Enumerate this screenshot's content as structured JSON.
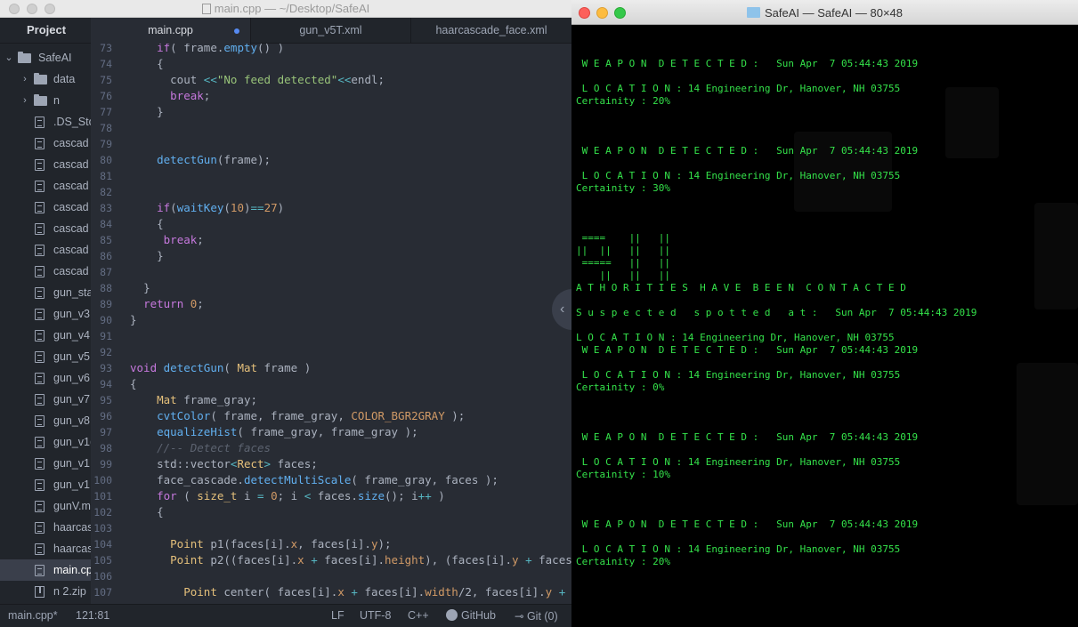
{
  "editor": {
    "window_title": "main.cpp — ~/Desktop/SafeAI",
    "sidebar": {
      "header": "Project",
      "root": "SafeAI",
      "items": [
        {
          "label": "data",
          "kind": "folder"
        },
        {
          "label": "n",
          "kind": "folder"
        },
        {
          "label": ".DS_Sto",
          "kind": "file"
        },
        {
          "label": "cascad",
          "kind": "file"
        },
        {
          "label": "cascad",
          "kind": "file"
        },
        {
          "label": "cascad",
          "kind": "file"
        },
        {
          "label": "cascad",
          "kind": "file"
        },
        {
          "label": "cascad",
          "kind": "file"
        },
        {
          "label": "cascad",
          "kind": "file"
        },
        {
          "label": "cascad",
          "kind": "file"
        },
        {
          "label": "gun_sta",
          "kind": "file"
        },
        {
          "label": "gun_v3",
          "kind": "file"
        },
        {
          "label": "gun_v4",
          "kind": "file"
        },
        {
          "label": "gun_v5",
          "kind": "file"
        },
        {
          "label": "gun_v6",
          "kind": "file"
        },
        {
          "label": "gun_v7",
          "kind": "file"
        },
        {
          "label": "gun_v8",
          "kind": "file"
        },
        {
          "label": "gun_v1(",
          "kind": "file"
        },
        {
          "label": "gun_v1",
          "kind": "file"
        },
        {
          "label": "gun_v1",
          "kind": "file"
        },
        {
          "label": "gunV.m",
          "kind": "file"
        },
        {
          "label": "haarcas",
          "kind": "file"
        },
        {
          "label": "haarcas",
          "kind": "file"
        },
        {
          "label": "main.cp",
          "kind": "file",
          "selected": true
        },
        {
          "label": "n 2.zip",
          "kind": "zip"
        }
      ]
    },
    "tabs": [
      {
        "label": "main.cpp",
        "active": true,
        "modified": true
      },
      {
        "label": "gun_v5T.xml",
        "active": false
      },
      {
        "label": "haarcascade_face.xml",
        "active": false
      }
    ],
    "code_lines": [
      {
        "n": "73",
        "indent": "    ",
        "tokens": [
          [
            "k",
            "if"
          ],
          [
            "p",
            "( frame."
          ],
          [
            "f",
            "empty"
          ],
          [
            "p",
            "() )"
          ]
        ]
      },
      {
        "n": "74",
        "indent": "    ",
        "tokens": [
          [
            "p",
            "{"
          ]
        ]
      },
      {
        "n": "75",
        "indent": "      ",
        "tokens": [
          [
            "p",
            "cout "
          ],
          [
            "o",
            "<<"
          ],
          [
            "s",
            "\"No feed detected\""
          ],
          [
            "o",
            "<<"
          ],
          [
            "p",
            "endl;"
          ]
        ]
      },
      {
        "n": "76",
        "indent": "      ",
        "tokens": [
          [
            "k",
            "break"
          ],
          [
            "p",
            ";"
          ]
        ]
      },
      {
        "n": "77",
        "indent": "    ",
        "tokens": [
          [
            "p",
            "}"
          ]
        ]
      },
      {
        "n": "78",
        "indent": "",
        "tokens": []
      },
      {
        "n": "79",
        "indent": "",
        "tokens": []
      },
      {
        "n": "80",
        "indent": "    ",
        "tokens": [
          [
            "f",
            "detectGun"
          ],
          [
            "p",
            "(frame);"
          ]
        ]
      },
      {
        "n": "81",
        "indent": "",
        "tokens": []
      },
      {
        "n": "82",
        "indent": "",
        "tokens": []
      },
      {
        "n": "83",
        "indent": "    ",
        "tokens": [
          [
            "k",
            "if"
          ],
          [
            "p",
            "("
          ],
          [
            "f",
            "waitKey"
          ],
          [
            "p",
            "("
          ],
          [
            "n",
            "10"
          ],
          [
            "p",
            ")"
          ],
          [
            "o",
            "=="
          ],
          [
            "n",
            "27"
          ],
          [
            "p",
            ")"
          ]
        ]
      },
      {
        "n": "84",
        "indent": "    ",
        "tokens": [
          [
            "p",
            "{"
          ]
        ]
      },
      {
        "n": "85",
        "indent": "     ",
        "tokens": [
          [
            "k",
            "break"
          ],
          [
            "p",
            ";"
          ]
        ]
      },
      {
        "n": "86",
        "indent": "    ",
        "tokens": [
          [
            "p",
            "}"
          ]
        ]
      },
      {
        "n": "87",
        "indent": "",
        "tokens": []
      },
      {
        "n": "88",
        "indent": "  ",
        "tokens": [
          [
            "p",
            "}"
          ]
        ]
      },
      {
        "n": "89",
        "indent": "  ",
        "tokens": [
          [
            "k",
            "return"
          ],
          [
            "p",
            " "
          ],
          [
            "n",
            "0"
          ],
          [
            "p",
            ";"
          ]
        ]
      },
      {
        "n": "90",
        "indent": "",
        "tokens": [
          [
            "p",
            "}"
          ]
        ]
      },
      {
        "n": "91",
        "indent": "",
        "tokens": []
      },
      {
        "n": "92",
        "indent": "",
        "tokens": []
      },
      {
        "n": "93",
        "indent": "",
        "tokens": [
          [
            "k",
            "void"
          ],
          [
            "p",
            " "
          ],
          [
            "f",
            "detectGun"
          ],
          [
            "p",
            "( "
          ],
          [
            "t",
            "Mat"
          ],
          [
            "p",
            " frame )"
          ]
        ]
      },
      {
        "n": "94",
        "indent": "",
        "tokens": [
          [
            "p",
            "{"
          ]
        ]
      },
      {
        "n": "95",
        "indent": "    ",
        "tokens": [
          [
            "t",
            "Mat"
          ],
          [
            "p",
            " frame_gray;"
          ]
        ]
      },
      {
        "n": "96",
        "indent": "    ",
        "tokens": [
          [
            "f",
            "cvtColor"
          ],
          [
            "p",
            "( frame, frame_gray, "
          ],
          [
            "n",
            "COLOR_BGR2GRAY"
          ],
          [
            "p",
            " );"
          ]
        ]
      },
      {
        "n": "97",
        "indent": "    ",
        "tokens": [
          [
            "f",
            "equalizeHist"
          ],
          [
            "p",
            "( frame_gray, frame_gray );"
          ]
        ]
      },
      {
        "n": "98",
        "indent": "    ",
        "tokens": [
          [
            "c",
            "//-- Detect faces"
          ]
        ]
      },
      {
        "n": "99",
        "indent": "    ",
        "tokens": [
          [
            "p",
            "std::vector"
          ],
          [
            "o",
            "<"
          ],
          [
            "t",
            "Rect"
          ],
          [
            "o",
            ">"
          ],
          [
            "p",
            " faces;"
          ]
        ]
      },
      {
        "n": "100",
        "indent": "    ",
        "tokens": [
          [
            "p",
            "face_cascade."
          ],
          [
            "f",
            "detectMultiScale"
          ],
          [
            "p",
            "( frame_gray, faces );"
          ]
        ]
      },
      {
        "n": "101",
        "indent": "    ",
        "tokens": [
          [
            "k",
            "for"
          ],
          [
            "p",
            " ( "
          ],
          [
            "t",
            "size_t"
          ],
          [
            "p",
            " i "
          ],
          [
            "o",
            "="
          ],
          [
            "p",
            " "
          ],
          [
            "n",
            "0"
          ],
          [
            "p",
            "; i "
          ],
          [
            "o",
            "<"
          ],
          [
            "p",
            " faces."
          ],
          [
            "f",
            "size"
          ],
          [
            "p",
            "(); i"
          ],
          [
            "o",
            "++"
          ],
          [
            "p",
            " )"
          ]
        ]
      },
      {
        "n": "102",
        "indent": "    ",
        "tokens": [
          [
            "p",
            "{"
          ]
        ]
      },
      {
        "n": "103",
        "indent": "",
        "tokens": []
      },
      {
        "n": "104",
        "indent": "      ",
        "tokens": [
          [
            "t",
            "Point"
          ],
          [
            "p",
            " p1(faces[i]."
          ],
          [
            "n",
            "x"
          ],
          [
            "p",
            ", faces[i]."
          ],
          [
            "n",
            "y"
          ],
          [
            "p",
            ");"
          ]
        ]
      },
      {
        "n": "105",
        "indent": "      ",
        "tokens": [
          [
            "t",
            "Point"
          ],
          [
            "p",
            " p2((faces[i]."
          ],
          [
            "n",
            "x"
          ],
          [
            "p",
            " "
          ],
          [
            "o",
            "+"
          ],
          [
            "p",
            " faces[i]."
          ],
          [
            "n",
            "height"
          ],
          [
            "p",
            "), (faces[i]."
          ],
          [
            "n",
            "y"
          ],
          [
            "p",
            " "
          ],
          [
            "o",
            "+"
          ],
          [
            "p",
            " faces[i]"
          ]
        ]
      },
      {
        "n": "106",
        "indent": "",
        "tokens": []
      },
      {
        "n": "107",
        "indent": "        ",
        "tokens": [
          [
            "t",
            "Point"
          ],
          [
            "p",
            " center( faces[i]."
          ],
          [
            "n",
            "x"
          ],
          [
            "p",
            " "
          ],
          [
            "o",
            "+"
          ],
          [
            "p",
            " faces[i]."
          ],
          [
            "n",
            "width"
          ],
          [
            "p",
            "/2, faces[i]."
          ],
          [
            "n",
            "y"
          ],
          [
            "p",
            " "
          ],
          [
            "o",
            "+"
          ],
          [
            "p",
            " face"
          ]
        ]
      }
    ],
    "status": {
      "file": "main.cpp*",
      "cursor": "121:81",
      "line_ending": "LF",
      "encoding": "UTF-8",
      "grammar": "C++",
      "github": "GitHub",
      "git": "Git (0)"
    }
  },
  "terminal": {
    "window_title": "SafeAI — SafeAI — 80×48",
    "lines": [
      " ",
      " ",
      " W E A P O N  D E T E C T E D :   Sun Apr  7 05:44:43 2019",
      " ",
      " L O C A T I O N : 14 Engineering Dr, Hanover, NH 03755",
      "Certainity : 20%",
      " ",
      " ",
      " ",
      " W E A P O N  D E T E C T E D :   Sun Apr  7 05:44:43 2019",
      " ",
      " L O C A T I O N : 14 Engineering Dr, Hanover, NH 03755",
      "Certainity : 30%",
      " ",
      " ",
      " ",
      " ====    ||   ||",
      "||  ||   ||   ||",
      " =====   ||   ||",
      "    ||   ||   ||",
      "A T H O R I T I E S  H A V E  B E E N  C O N T A C T E D",
      " ",
      "S u s p e c t e d   s p o t t e d   a t :   Sun Apr  7 05:44:43 2019",
      " ",
      "L O C A T I O N : 14 Engineering Dr, Hanover, NH 03755",
      " W E A P O N  D E T E C T E D :   Sun Apr  7 05:44:43 2019",
      " ",
      " L O C A T I O N : 14 Engineering Dr, Hanover, NH 03755",
      "Certainity : 0%",
      " ",
      " ",
      " ",
      " W E A P O N  D E T E C T E D :   Sun Apr  7 05:44:43 2019",
      " ",
      " L O C A T I O N : 14 Engineering Dr, Hanover, NH 03755",
      "Certainity : 10%",
      " ",
      " ",
      " ",
      " W E A P O N  D E T E C T E D :   Sun Apr  7 05:44:43 2019",
      " ",
      " L O C A T I O N : 14 Engineering Dr, Hanover, NH 03755",
      "Certainity : 20%"
    ]
  },
  "colors": {
    "editor_bg": "#282c34",
    "sidebar_bg": "#21252b",
    "terminal_bg": "#000000",
    "terminal_text": "#34e24a",
    "modified_dot": "#568af2"
  }
}
